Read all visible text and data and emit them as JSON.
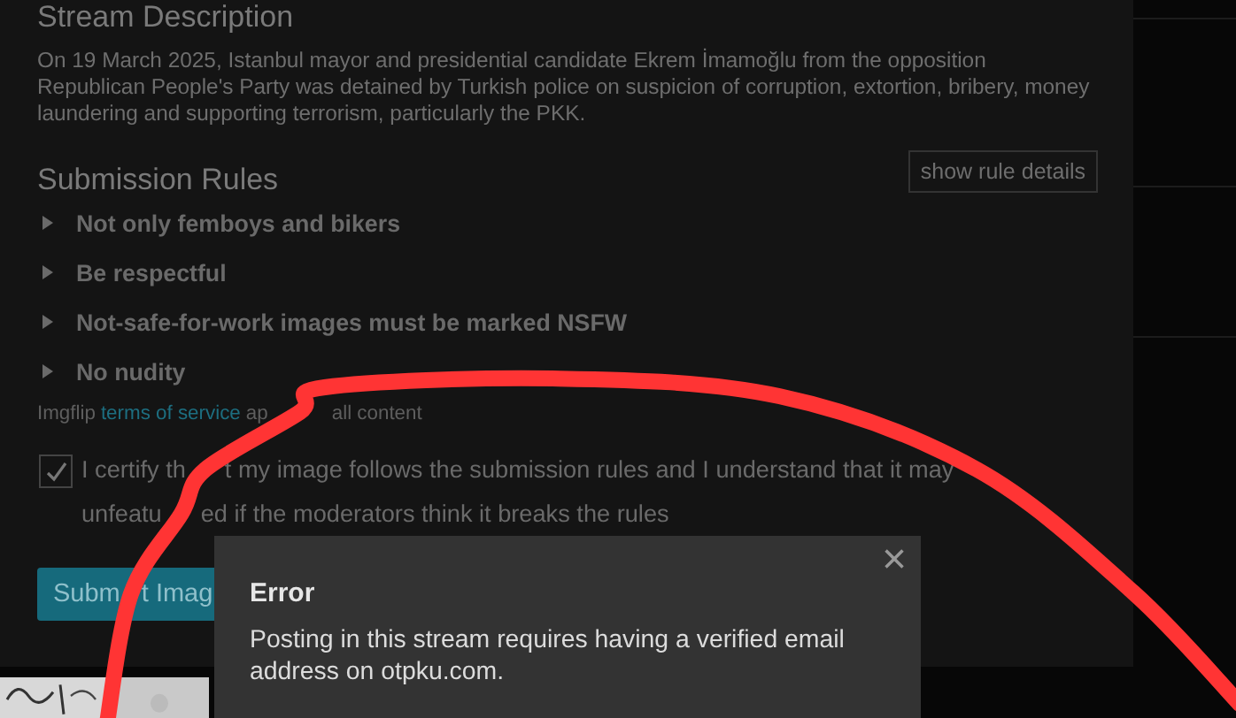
{
  "stream_description": {
    "heading": "Stream Description",
    "text": "On 19 March 2025, Istanbul mayor and presidential candidate Ekrem İmamoğlu from the opposition Republican People's Party was detained by Turkish police on suspicion of corruption, extortion, bribery, money laundering and supporting terrorism, particularly the PKK."
  },
  "submission_rules": {
    "heading": "Submission Rules",
    "details_button": "show rule details",
    "rules": [
      {
        "text": "Not only femboys and bikers",
        "expanded": false
      },
      {
        "text": "Be respectful",
        "expanded": false
      },
      {
        "text": "Not-safe-for-work images must be marked NSFW",
        "expanded": false
      },
      {
        "text": "No nudity",
        "expanded": false
      }
    ],
    "terms": {
      "prefix": "Imgflip",
      "link": "terms of service",
      "suffix_parts": [
        "ap",
        "all content"
      ]
    }
  },
  "certify": {
    "checked": true,
    "lines": [
      [
        "I certify th",
        "t my image follows the submission rules and I understand that it may"
      ],
      [
        "unfeatu",
        "ed if the moderators think it breaks the rules"
      ]
    ]
  },
  "submit_button_parts": [
    "Subm",
    "t Imag"
  ],
  "error_dialog": {
    "title": "Error",
    "message": "Posting in this stream requires having a verified email address on otpku.com.",
    "close": "×"
  }
}
